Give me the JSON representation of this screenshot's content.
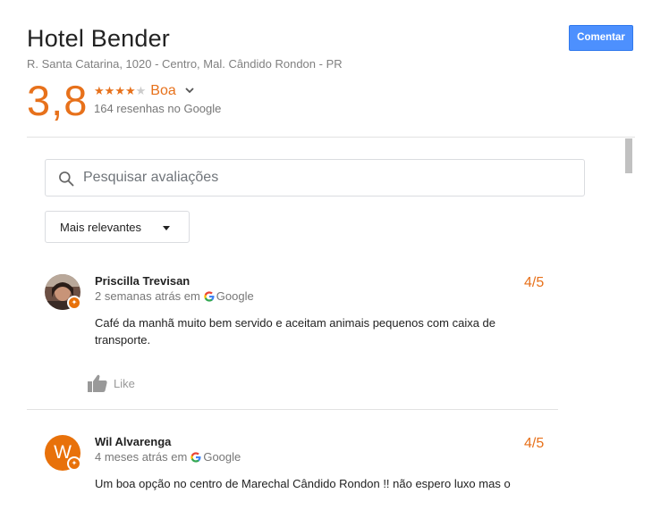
{
  "hotel": {
    "name": "Hotel Bender",
    "address": "R. Santa Catarina, 1020 - Centro, Mal. Cândido Rondon - PR"
  },
  "header": {
    "comment_label": "Comentar"
  },
  "rating": {
    "score": "3,8",
    "stars": 4,
    "max_stars": 5,
    "word": "Boa",
    "count_text": "164 resenhas no Google"
  },
  "search": {
    "placeholder": "Pesquisar avaliações",
    "value": ""
  },
  "sort": {
    "selected": "Mais relevantes"
  },
  "reviews": [
    {
      "name": "Priscilla Trevisan",
      "date": "2 semanas atrás em",
      "source": "Google",
      "score": "4/5",
      "text": "Café da manhã muito bem servido e aceitam animais pequenos com caixa de transporte.",
      "like_label": "Like",
      "avatar_type": "photo"
    },
    {
      "name": "Wil Alvarenga",
      "date": "4 meses atrás em",
      "source": "Google",
      "score": "4/5",
      "text": "Um boa opção no centro de Marechal Cândido Rondon !! não espero luxo mas o",
      "avatar_letter": "W",
      "avatar_type": "letter"
    }
  ],
  "colors": {
    "accent_orange": "#e7711b",
    "button_blue": "#4d90fe",
    "avatar_orange": "#e8710a"
  },
  "icons": {
    "search": "search-icon",
    "chevron": "chevron-down-icon",
    "like": "thumbs-up-icon",
    "google": "google-logo-icon",
    "local_guide": "local-guide-badge-icon"
  }
}
